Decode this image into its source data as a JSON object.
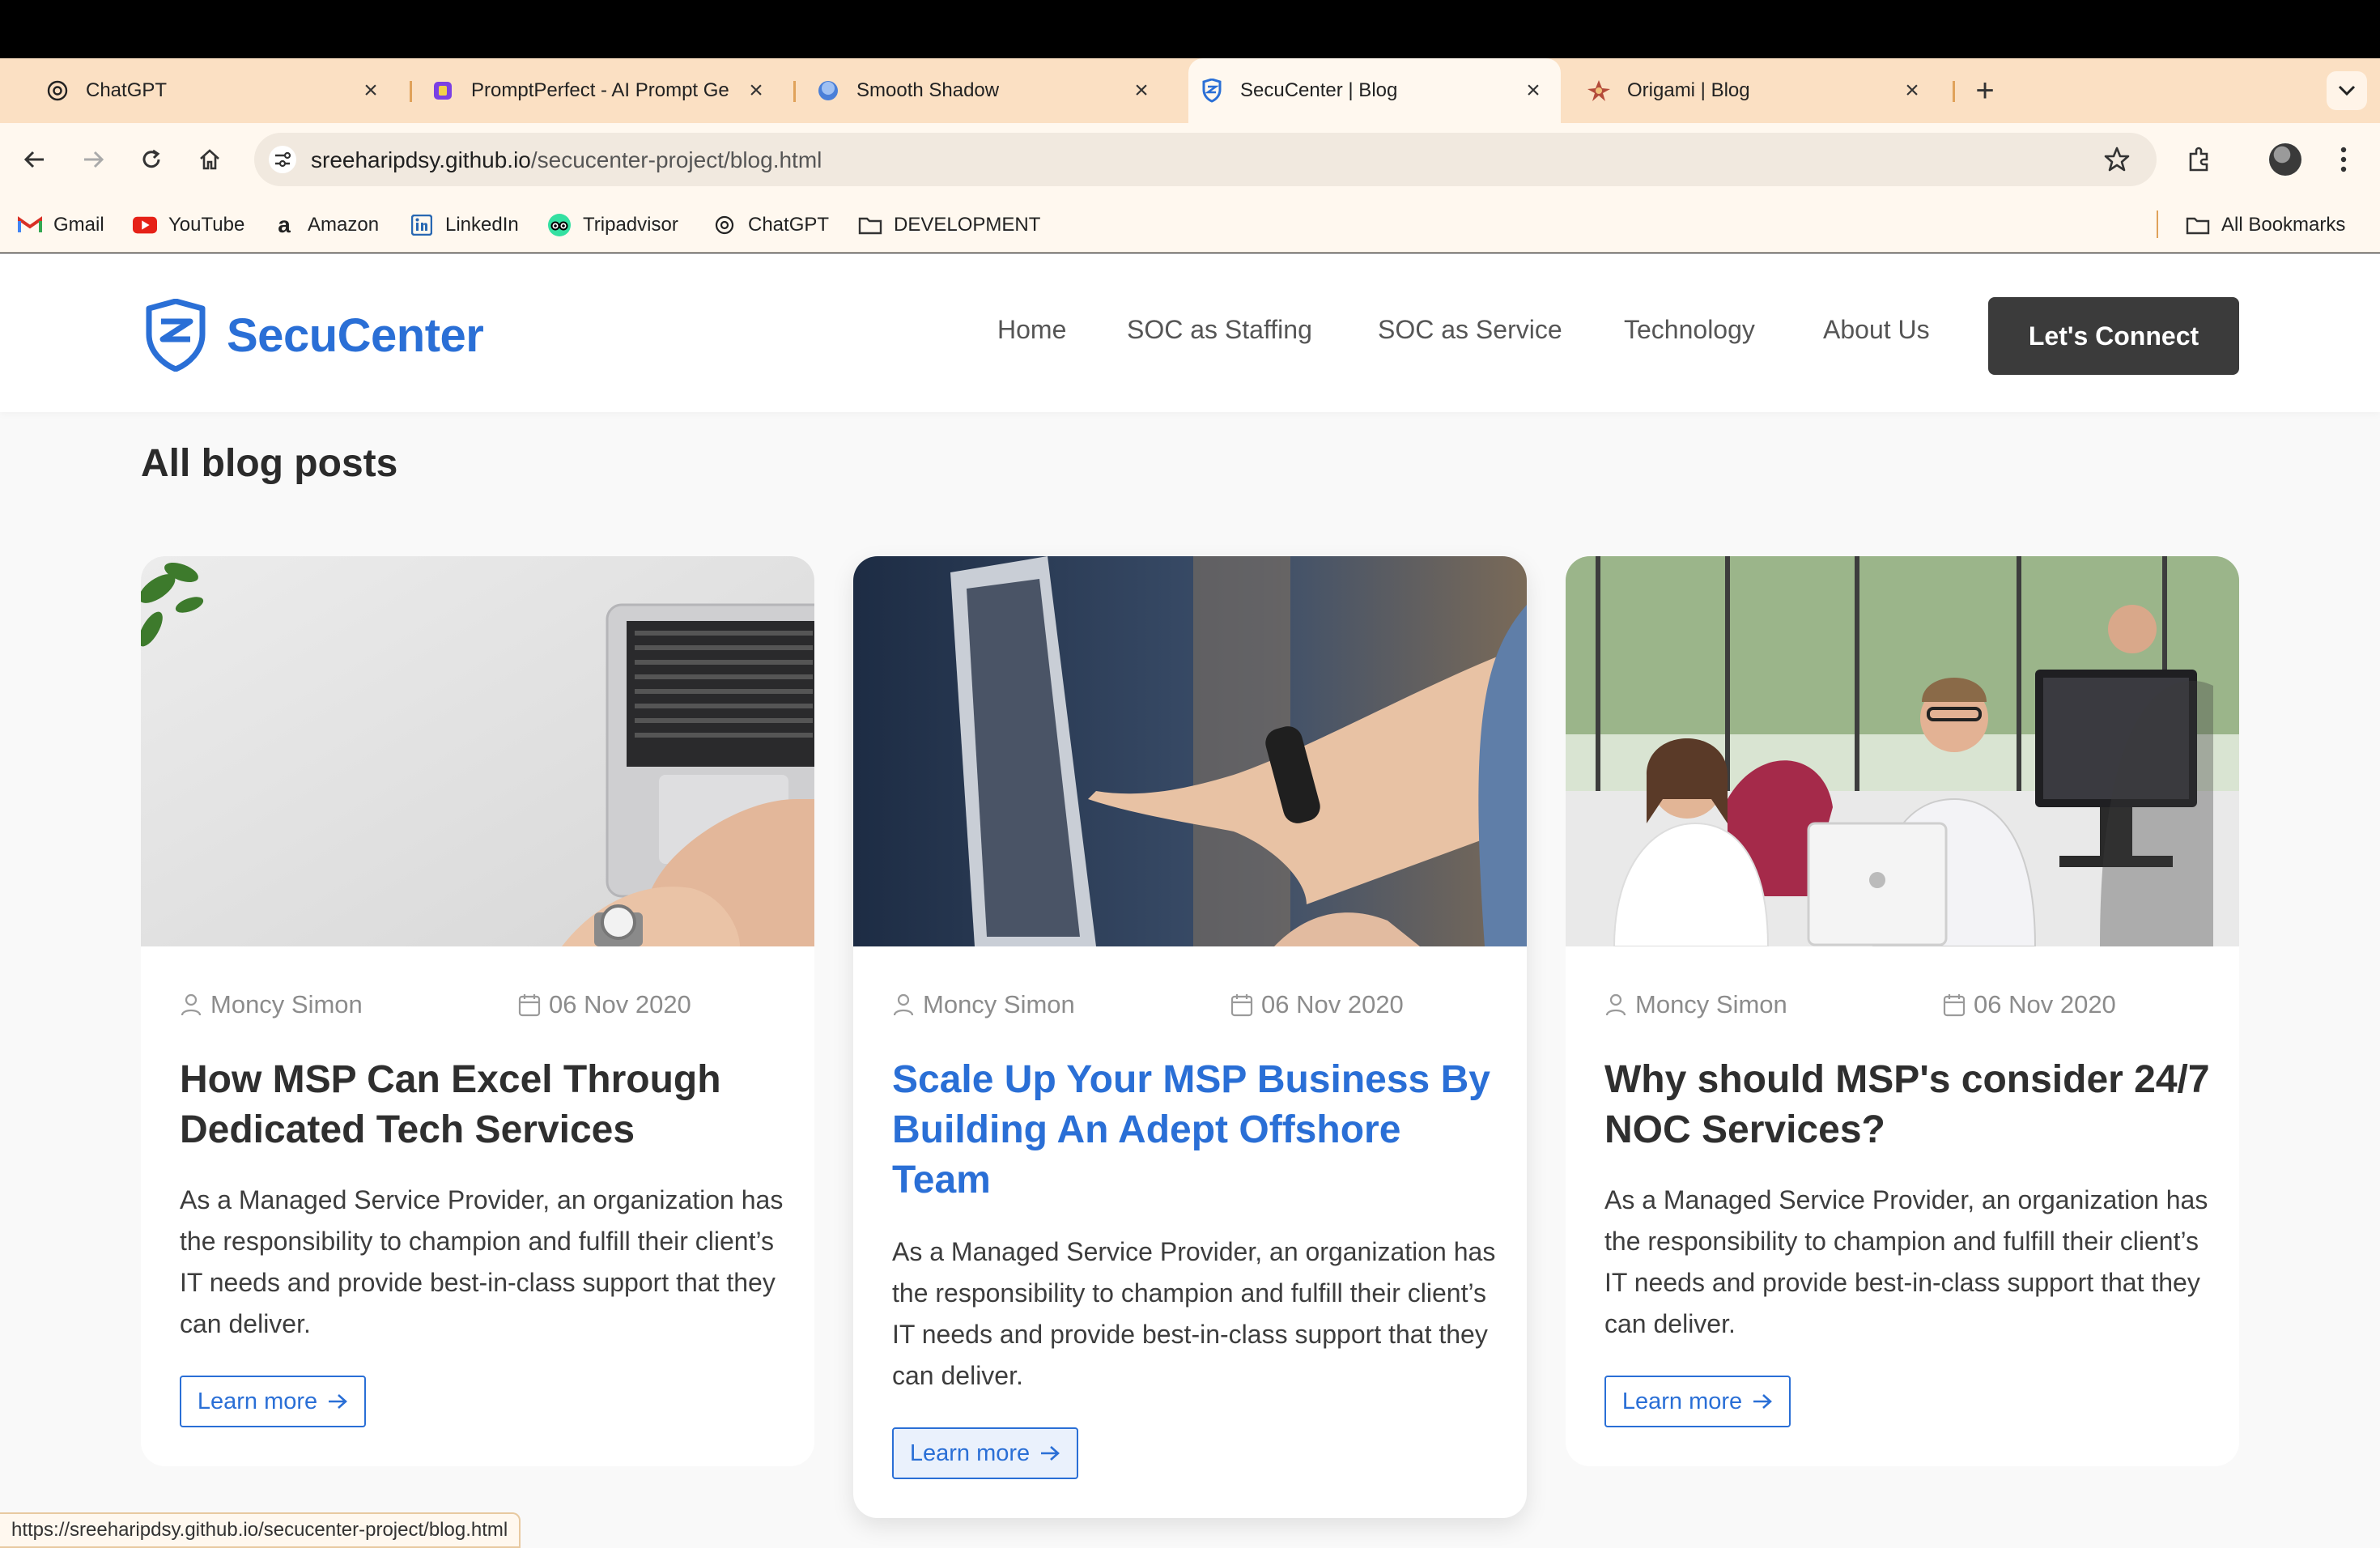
{
  "tabs": [
    {
      "title": "ChatGPT"
    },
    {
      "title": "PromptPerfect - AI Prompt Ge"
    },
    {
      "title": "Smooth Shadow"
    },
    {
      "title": "SecuCenter | Blog"
    },
    {
      "title": "Origami | Blog"
    }
  ],
  "address": {
    "host": "sreeharipdsy.github.io",
    "path": "/secucenter-project/blog.html"
  },
  "bookmarks": [
    "Gmail",
    "YouTube",
    "Amazon",
    "LinkedIn",
    "Tripadvisor",
    "ChatGPT",
    "DEVELOPMENT"
  ],
  "all_bookmarks": "All Bookmarks",
  "site": {
    "brand": "SecuCenter",
    "nav": [
      "Home",
      "SOC as Staffing",
      "SOC as Service",
      "Technology",
      "About Us"
    ],
    "cta": "Let's Connect",
    "section_title": "All blog posts"
  },
  "posts": [
    {
      "author": "Moncy Simon",
      "date": "06 Nov 2020",
      "title": "How MSP Can Excel Through Dedicated Tech Services",
      "excerpt": "As a Managed Service Provider, an organization has the responsibility to champion and fulfill their client’s IT needs and provide best-in-class support that they can deliver.",
      "button": "Learn more"
    },
    {
      "author": "Moncy Simon",
      "date": "06 Nov 2020",
      "title": "Scale Up Your MSP Business By Building An Adept Offshore Team",
      "excerpt": "As a Managed Service Provider, an organization has the responsibility to champion and fulfill their client’s IT needs and provide best-in-class support that they can deliver.",
      "button": "Learn more"
    },
    {
      "author": "Moncy Simon",
      "date": "06 Nov 2020",
      "title": "Why should MSP's consider 24/7 NOC Services?",
      "excerpt": "As a Managed Service Provider, an organization has the responsibility to champion and fulfill their client’s IT needs and provide best-in-class support that they can deliver.",
      "button": "Learn more"
    }
  ],
  "status_url": "https://sreeharipdsy.github.io/secucenter-project/blog.html",
  "colors": {
    "brand_blue": "#2a6fd6",
    "tab_strip": "#fbe0c3",
    "cta_bg": "#3b3b3b"
  }
}
